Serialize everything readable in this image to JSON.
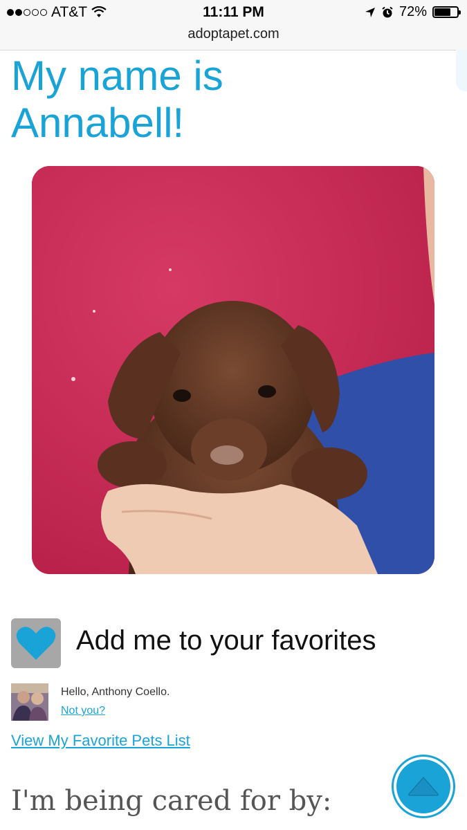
{
  "status_bar": {
    "carrier": "AT&T",
    "time": "11:11 PM",
    "battery": "72%",
    "battery_level": 0.72,
    "url": "adoptapet.com"
  },
  "page": {
    "title": "My name is Annabell!",
    "favorites_label": "Add me to your favorites",
    "hello_text": "Hello, Anthony Coello.",
    "not_you_link": "Not you?",
    "favorite_list_link": "View My Favorite Pets List",
    "cared_for_heading": "I'm being cared for by:"
  },
  "colors": {
    "accent": "#1aa3d6",
    "favorite_button_bg": "#a7a7a7",
    "photo_backdrop": "#cf2e58"
  },
  "icons": {
    "favorite": "heart-icon",
    "scroll_top": "up-arrow-icon"
  }
}
